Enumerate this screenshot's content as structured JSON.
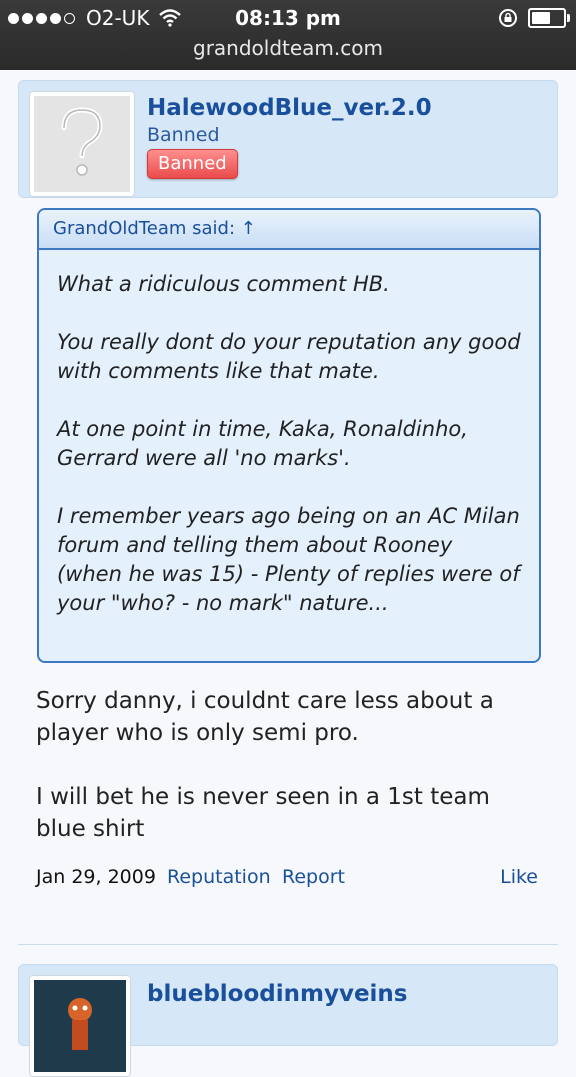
{
  "status_bar": {
    "carrier": "O2-UK",
    "time": "08:13 pm",
    "url": "grandoldteam.com",
    "battery_level": 0.6
  },
  "post": {
    "username": "HalewoodBlue_ver.2.0",
    "user_title": "Banned",
    "badge": "Banned",
    "quote_header": "GrandOldTeam said: ↑",
    "quote_paragraphs": [
      "What a ridiculous comment HB.",
      "You really dont do your reputation any good with comments like that mate.",
      "At one point in time, Kaka, Ronaldinho, Gerrard were all 'no marks'.",
      "I remember years ago being on an AC Milan forum and telling them about Rooney (when he was 15) - Plenty of replies were of your \"who? - no mark\" nature..."
    ],
    "message_paragraphs": [
      "Sorry danny, i couldnt care less about a player who is only semi pro.",
      "I will bet he is never seen in a 1st team blue shirt"
    ],
    "date": "Jan 29, 2009",
    "reputation_label": "Reputation",
    "report_label": "Report",
    "like_label": "Like"
  },
  "next_post": {
    "username": "bluebloodinmyveins"
  },
  "icons": {
    "signal": "signal-dots-icon",
    "wifi": "wifi-icon",
    "rotation_lock": "rotation-lock-icon",
    "battery": "battery-icon",
    "avatar_placeholder": "question-mark-icon"
  },
  "colors": {
    "link": "#1a4f9b",
    "card_bg": "#d6e8f8",
    "quote_border": "#3d78c3",
    "badge": "#ea4b4b"
  }
}
